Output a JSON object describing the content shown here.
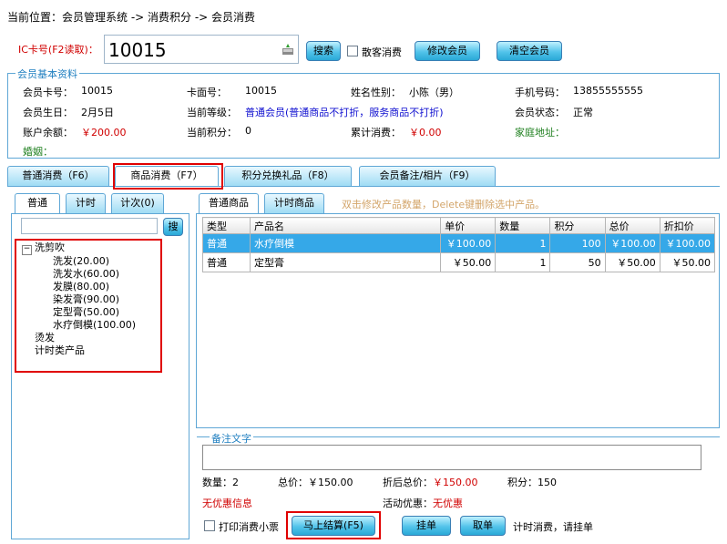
{
  "breadcrumb": "当前位置：会员管理系统 -> 消费积分 -> 会员消费",
  "ic": {
    "label": "IC卡号(F2读取)：",
    "value": "10015"
  },
  "buttons": {
    "search": "搜索",
    "edit_member": "修改会员",
    "clear_member": "清空会员",
    "pay_now": "马上结算(F5)",
    "hang": "挂单",
    "take": "取单"
  },
  "guest_checkbox_label": "散客消费",
  "member": {
    "legend": "会员基本资料",
    "card_no_label": "会员卡号：",
    "card_no": "10015",
    "face_no_label": "卡面号：",
    "face_no": "10015",
    "name_label": "姓名性别：",
    "name": "小陈（男）",
    "phone_label": "手机号码：",
    "phone": "13855555555",
    "birthday_label": "会员生日：",
    "birthday": "2月5日",
    "level_label": "当前等级：",
    "level": "普通会员(普通商品不打折，服务商品不打折)",
    "status_label": "会员状态：",
    "status": "正常",
    "balance_label": "账户余额：",
    "balance": "￥200.00",
    "points_label": "当前积分：",
    "points": "0",
    "total_label": "累计消费：",
    "total": "￥0.00",
    "address_label": "家庭地址：",
    "marriage_label": "婚姻："
  },
  "main_tabs": [
    "普通消费（F6）",
    "商品消费（F7）",
    "积分兑换礼品（F8）",
    "会员备注/相片（F9）"
  ],
  "left_tabs": [
    "普通",
    "计时",
    "计次(0)"
  ],
  "left_search_button": "搜",
  "tree": {
    "root1": "洗剪吹",
    "children": [
      "洗发(20.00)",
      "洗发水(60.00)",
      "发膜(80.00)",
      "染发膏(90.00)",
      "定型膏(50.00)",
      "水疗倒模(100.00)"
    ],
    "root2": "烫发",
    "root3": "计时类产品"
  },
  "right_tabs": [
    "普通商品",
    "计时商品"
  ],
  "hint": "双击修改产品数量，Delete键删除选中产品。",
  "table": {
    "headers": [
      "类型",
      "产品名",
      "单价",
      "数量",
      "积分",
      "总价",
      "折扣价"
    ],
    "rows": [
      [
        "普通",
        "水疗倒模",
        "￥100.00",
        "1",
        "100",
        "￥100.00",
        "￥100.00"
      ],
      [
        "普通",
        "定型膏",
        "￥50.00",
        "1",
        "50",
        "￥50.00",
        "￥50.00"
      ]
    ]
  },
  "notes_legend": "备注文字",
  "summary": {
    "qty_label": "数量：",
    "qty": "2",
    "total_label": "总价：",
    "total": "￥150.00",
    "disc_total_label": "折后总价：",
    "disc_total": "￥150.00",
    "points_label": "积分：",
    "points": "150",
    "no_discount": "无优惠信息",
    "promo_label": "活动优惠：",
    "promo": "无优惠"
  },
  "print_checkbox_label": "打印消费小票",
  "status_text": "计时消费，请挂单"
}
